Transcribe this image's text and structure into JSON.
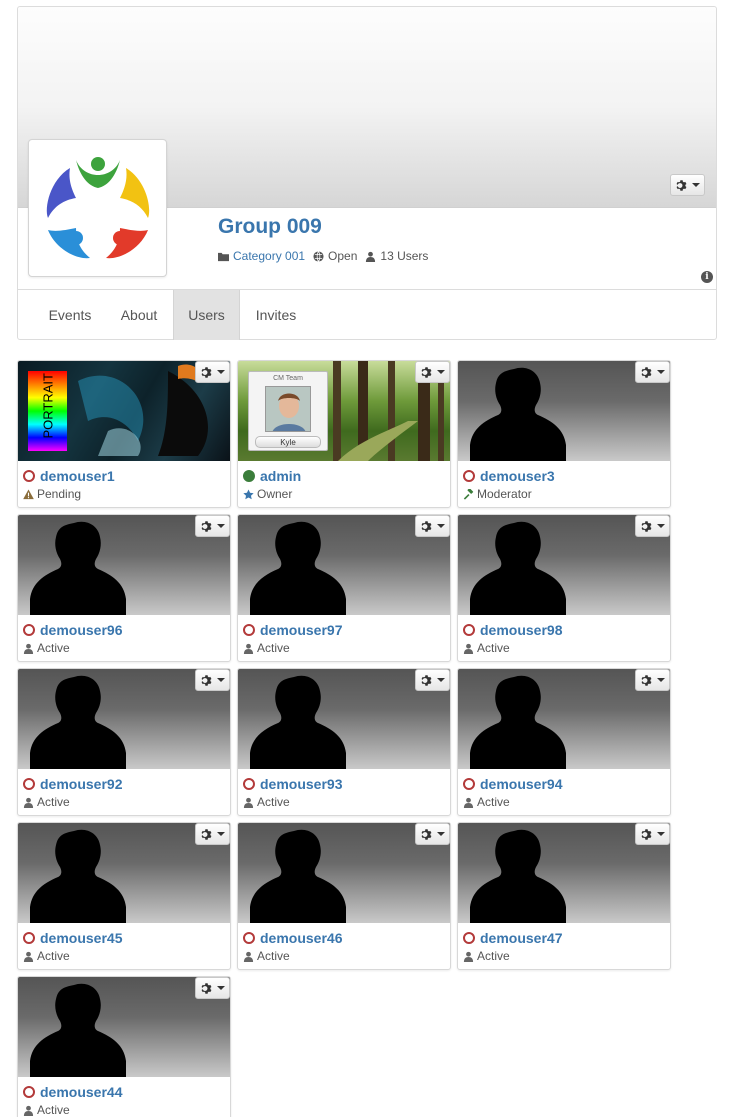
{
  "group": {
    "title": "Group 009",
    "category": "Category 001",
    "privacy": "Open",
    "users_count": "13 Users"
  },
  "tabs": [
    {
      "label": "Events"
    },
    {
      "label": "About"
    },
    {
      "label": "Users",
      "active": true
    },
    {
      "label": "Invites"
    }
  ],
  "members": [
    {
      "name": "demouser1",
      "role": "Pending",
      "role_icon": "warning-icon",
      "status": "offline",
      "cover": "portrait-art"
    },
    {
      "name": "admin",
      "role": "Owner",
      "role_icon": "star-icon",
      "status": "online",
      "cover": "forest-with-photo"
    },
    {
      "name": "demouser3",
      "role": "Moderator",
      "role_icon": "gavel-icon",
      "status": "offline",
      "cover": "silhouette"
    },
    {
      "name": "demouser96",
      "role": "Active",
      "role_icon": "user-icon",
      "status": "offline",
      "cover": "silhouette"
    },
    {
      "name": "demouser97",
      "role": "Active",
      "role_icon": "user-icon",
      "status": "offline",
      "cover": "silhouette"
    },
    {
      "name": "demouser98",
      "role": "Active",
      "role_icon": "user-icon",
      "status": "offline",
      "cover": "silhouette"
    },
    {
      "name": "demouser92",
      "role": "Active",
      "role_icon": "user-icon",
      "status": "offline",
      "cover": "silhouette"
    },
    {
      "name": "demouser93",
      "role": "Active",
      "role_icon": "user-icon",
      "status": "offline",
      "cover": "silhouette"
    },
    {
      "name": "demouser94",
      "role": "Active",
      "role_icon": "user-icon",
      "status": "offline",
      "cover": "silhouette"
    },
    {
      "name": "demouser45",
      "role": "Active",
      "role_icon": "user-icon",
      "status": "offline",
      "cover": "silhouette"
    },
    {
      "name": "demouser46",
      "role": "Active",
      "role_icon": "user-icon",
      "status": "offline",
      "cover": "silhouette"
    },
    {
      "name": "demouser47",
      "role": "Active",
      "role_icon": "user-icon",
      "status": "offline",
      "cover": "silhouette"
    },
    {
      "name": "demouser44",
      "role": "Active",
      "role_icon": "user-icon",
      "status": "offline",
      "cover": "silhouette"
    }
  ],
  "cover_text": {
    "portrait": "PORTRAIT",
    "badge_header": "CM Team",
    "badge_name": "Kyle"
  },
  "colors": {
    "link": "#3a76ad",
    "offline": "#b33a3a",
    "online": "#3b7d3b"
  }
}
